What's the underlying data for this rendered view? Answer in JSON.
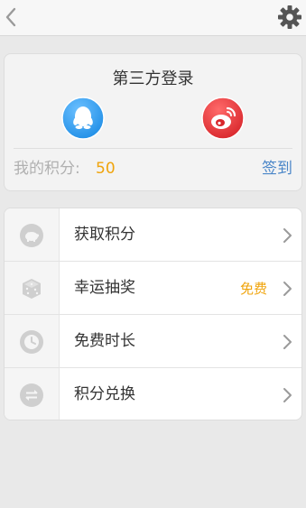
{
  "topbar": {
    "back_icon": "chevron-left-icon",
    "settings_icon": "gear-icon"
  },
  "login": {
    "title": "第三方登录",
    "providers": [
      {
        "name": "qq",
        "icon": "qq-penguin-icon",
        "color": "#3fa3ef"
      },
      {
        "name": "weibo",
        "icon": "weibo-icon",
        "color": "#e8393c"
      }
    ],
    "points_label": "我的积分:",
    "points_value": "50",
    "checkin_label": "签到"
  },
  "menu": {
    "items": [
      {
        "label": "获取积分",
        "icon": "piggy-bank-icon",
        "badge": ""
      },
      {
        "label": "幸运抽奖",
        "icon": "dice-icon",
        "badge": "免费"
      },
      {
        "label": "免费时长",
        "icon": "clock-icon",
        "badge": ""
      },
      {
        "label": "积分兑换",
        "icon": "exchange-icon",
        "badge": ""
      }
    ]
  },
  "colors": {
    "accent_orange": "#f0a40c",
    "link_blue": "#4a86c8"
  }
}
